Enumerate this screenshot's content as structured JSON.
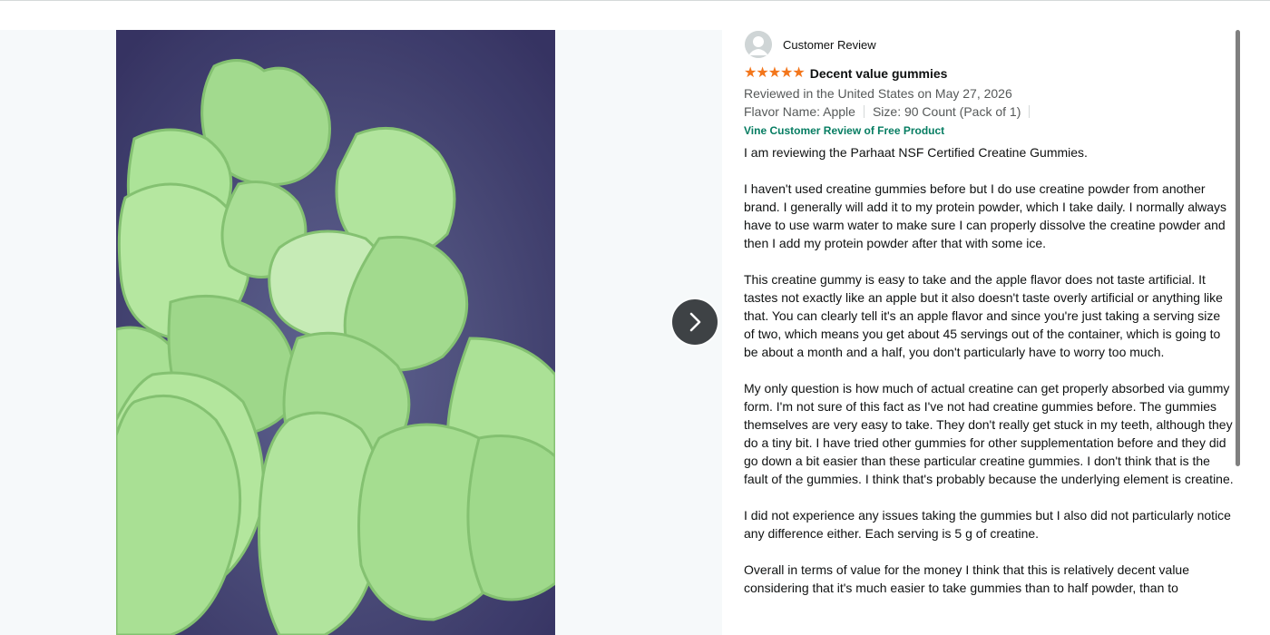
{
  "review": {
    "profile_name": "Customer Review",
    "rating": 5,
    "stars": "★★★★★",
    "title": "Decent value gummies",
    "reviewed_in": "Reviewed in the United States on May 27, 2026",
    "flavor": "Flavor Name: Apple",
    "size": "Size: 90 Count (Pack of 1)",
    "vine_badge": "Vine Customer Review of Free Product",
    "paragraphs": [
      "I am reviewing the Parhaat NSF Certified Creatine Gummies.",
      "I haven't used creatine gummies before but I do use creatine powder from another brand. I generally will add it to my protein powder, which I take daily. I normally always have to use warm water to make sure I can properly dissolve the creatine powder and then I add my protein powder after that with some ice.",
      "This creatine gummy is easy to take and the apple flavor does not taste artificial. It tastes not exactly like an apple but it also doesn't taste overly artificial or anything like that. You can clearly tell it's an apple flavor and since you're just taking a serving size of two, which means you get about 45 servings out of the container, which is going to be about a month and a half, you don't particularly have to worry too much.",
      "My only question is how much of actual creatine can get properly absorbed via gummy form. I'm not sure of this fact as I've not had creatine gummies before. The gummies themselves are very easy to take. They don't really get stuck in my teeth, although they do a tiny bit. I have tried other gummies for other supplementation before and they did go down a bit easier than these particular creatine gummies. I don't think that is the fault of the gummies. I think that's probably because the underlying element is creatine.",
      "I did not experience any issues taking the gummies but I also did not particularly notice any difference either. Each serving is 5 g of creatine.",
      "Overall in terms of value for the money I think that this is relatively decent value considering that it's much easier to take gummies than to half powder, than to"
    ]
  },
  "icons": {
    "avatar": "user-avatar-icon",
    "next": "chevron-right-icon",
    "star": "star-icon"
  },
  "colors": {
    "star": "#f3761b",
    "vine": "#067d62",
    "next_button": "#3e4245",
    "media_background": "#f6f9fa"
  }
}
